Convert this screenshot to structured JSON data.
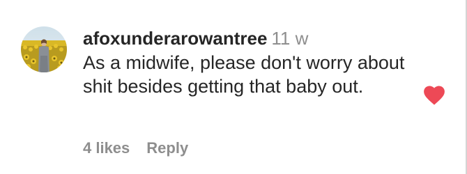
{
  "comment": {
    "username": "afoxunderarowantree",
    "timestamp": "11 w",
    "text": "As a midwife, please don't worry about shit besides getting that baby out.",
    "likes": "4 likes",
    "reply_label": "Reply",
    "liked": true,
    "heart_color": "#ed4956",
    "avatar_icon": "profile-photo-sunflower-field"
  }
}
